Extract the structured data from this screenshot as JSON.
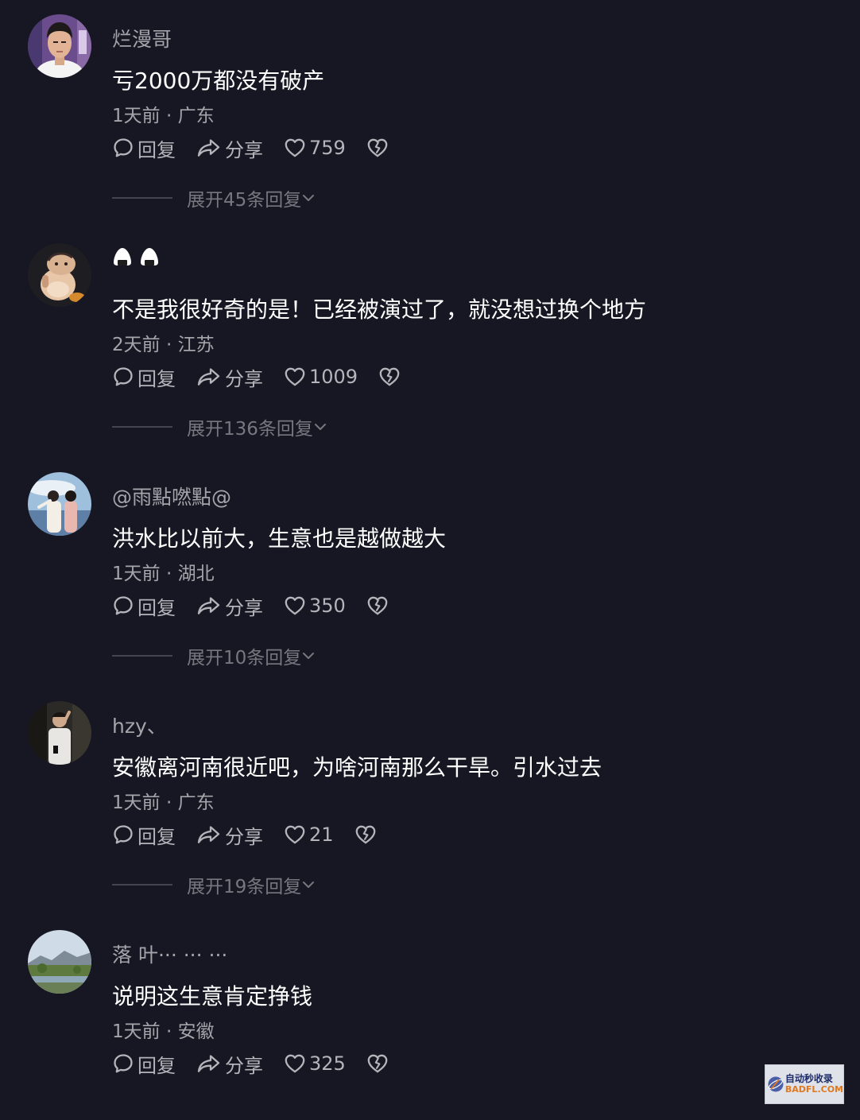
{
  "comments": [
    {
      "username": "烂漫哥",
      "text": "亏2000万都没有破产",
      "meta": "1天前 · 广东",
      "reply_label": "回复",
      "share_label": "分享",
      "likes": "759",
      "expand_label": "展开45条回复"
    },
    {
      "username": "",
      "username_icons": [
        "onigiri-icon",
        "onigiri-icon"
      ],
      "text": "不是我很好奇的是！已经被演过了，就没想过换个地方",
      "meta": "2天前 · 江苏",
      "reply_label": "回复",
      "share_label": "分享",
      "likes": "1009",
      "expand_label": "展开136条回复"
    },
    {
      "username": "@雨點嘫點@",
      "text": "洪水比以前大，生意也是越做越大",
      "meta": "1天前 · 湖北",
      "reply_label": "回复",
      "share_label": "分享",
      "likes": "350",
      "expand_label": "展开10条回复"
    },
    {
      "username": "hzy、",
      "text": "安徽离河南很近吧，为啥河南那么干旱。引水过去",
      "meta": "1天前 · 广东",
      "reply_label": "回复",
      "share_label": "分享",
      "likes": "21",
      "expand_label": "展开19条回复"
    },
    {
      "username": "落 叶··· ··· ···",
      "text": "说明这生意肯定挣钱",
      "meta": "1天前 · 安徽",
      "reply_label": "回复",
      "share_label": "分享",
      "likes": "325"
    }
  ],
  "watermark": {
    "line1": "自动秒收录",
    "line2": "BADFL.COM"
  },
  "colors": {
    "background": "#161722",
    "text": "#ffffff",
    "secondary": "#a4a5ab",
    "muted": "#76777f"
  }
}
